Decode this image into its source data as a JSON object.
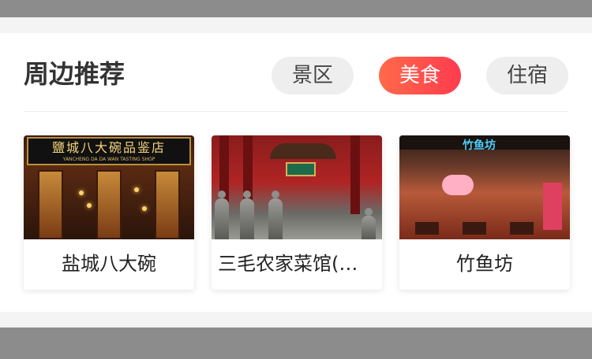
{
  "section": {
    "title": "周边推荐"
  },
  "tabs": [
    {
      "label": "景区",
      "active": false
    },
    {
      "label": "美食",
      "active": true
    },
    {
      "label": "住宿",
      "active": false
    }
  ],
  "items": [
    {
      "name": "盐城八大碗",
      "photo_sign": "鹽城八大碗品鉴店",
      "photo_sign_sub": "YANCHENG DA DA WAN TASTING SHOP"
    },
    {
      "name": "三毛农家菜馆(体…"
    },
    {
      "name": "竹鱼坊",
      "photo_sign": "竹鱼坊"
    }
  ],
  "colors": {
    "accent_start": "#ff6a4a",
    "accent_end": "#ff3b4e",
    "tab_bg": "#eeeeee",
    "title_text": "#333333"
  }
}
